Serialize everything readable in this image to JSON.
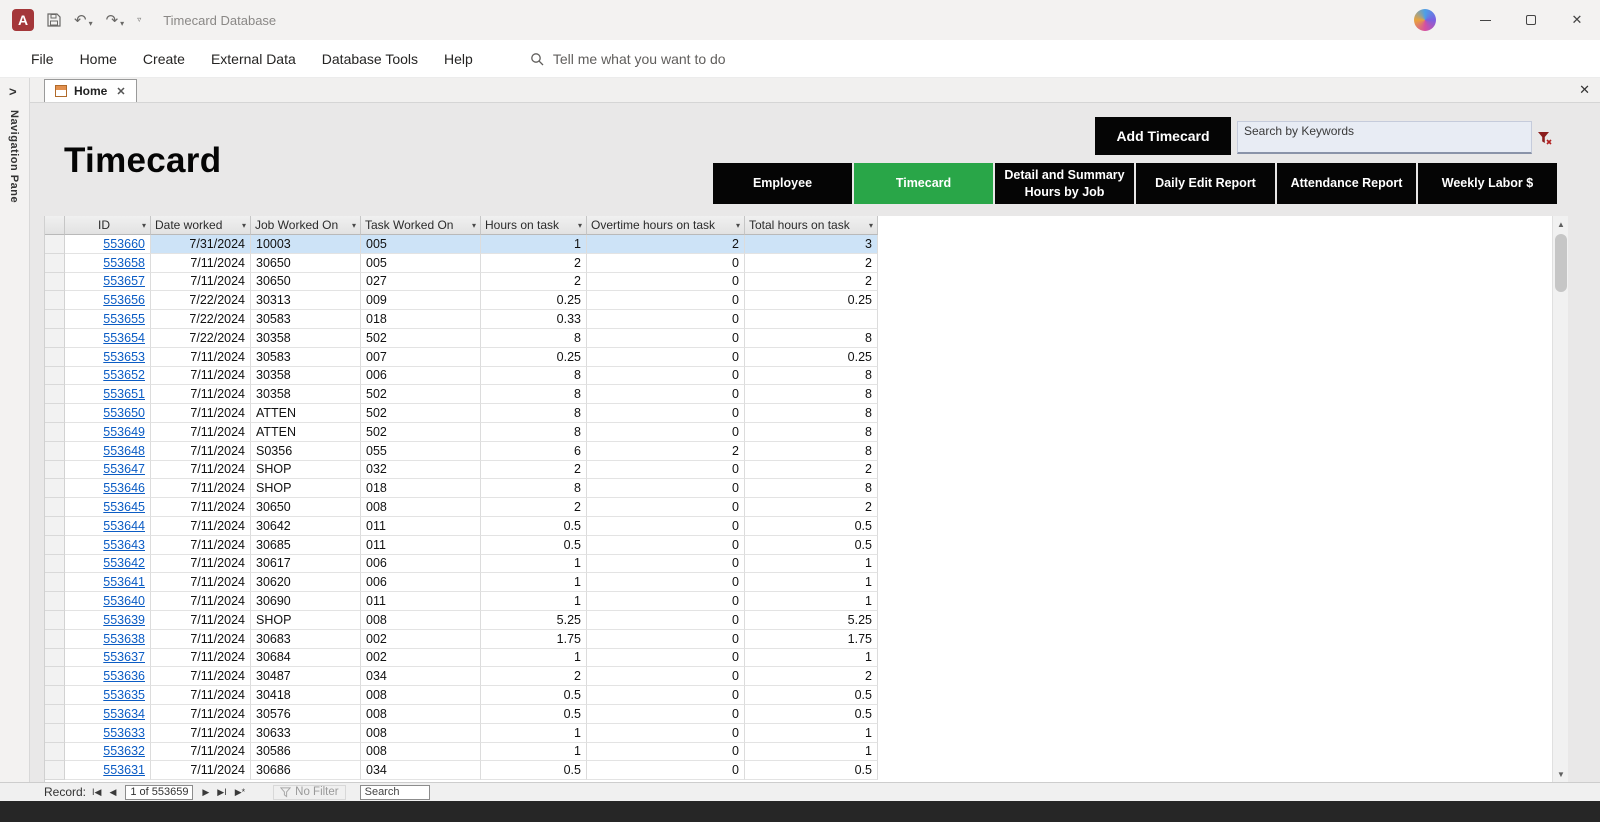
{
  "colors": {
    "accent_green": "#29a648",
    "button_black": "#050505",
    "access_red": "#a4373a",
    "link_blue": "#0b5cc4",
    "selected_row": "#cde3f7"
  },
  "titlebar": {
    "title": "Timecard Database"
  },
  "ribbon": {
    "tabs": [
      "File",
      "Home",
      "Create",
      "External Data",
      "Database Tools",
      "Help"
    ],
    "tell_me": "Tell me what you want to do"
  },
  "doc_tab": {
    "label": "Home"
  },
  "nav_pane": {
    "label": "Navigation Pane"
  },
  "form": {
    "title": "Timecard",
    "add_button_label": "Add Timecard",
    "search_placeholder": "Search by Keywords",
    "nav_buttons": [
      {
        "label": "Employee",
        "active": false
      },
      {
        "label": "Timecard",
        "active": true
      },
      {
        "label": "Detail and Summary Hours by Job",
        "active": false
      },
      {
        "label": "Daily Edit Report",
        "active": false
      },
      {
        "label": "Attendance Report",
        "active": false
      },
      {
        "label": "Weekly Labor $",
        "active": false
      }
    ]
  },
  "table": {
    "columns": [
      "ID",
      "Date worked",
      "Job Worked On",
      "Task Worked On",
      "Hours on task",
      "Overtime hours on task",
      "Total hours on task"
    ],
    "selected_row_index": 0,
    "rows": [
      [
        "553660",
        "7/31/2024",
        "10003",
        "005",
        "1",
        "2",
        "3"
      ],
      [
        "553658",
        "7/11/2024",
        "30650",
        "005",
        "2",
        "0",
        "2"
      ],
      [
        "553657",
        "7/11/2024",
        "30650",
        "027",
        "2",
        "0",
        "2"
      ],
      [
        "553656",
        "7/22/2024",
        "30313",
        "009",
        "0.25",
        "0",
        "0.25"
      ],
      [
        "553655",
        "7/22/2024",
        "30583",
        "018",
        "0.33",
        "0",
        ""
      ],
      [
        "553654",
        "7/22/2024",
        "30358",
        "502",
        "8",
        "0",
        "8"
      ],
      [
        "553653",
        "7/11/2024",
        "30583",
        "007",
        "0.25",
        "0",
        "0.25"
      ],
      [
        "553652",
        "7/11/2024",
        "30358",
        "006",
        "8",
        "0",
        "8"
      ],
      [
        "553651",
        "7/11/2024",
        "30358",
        "502",
        "8",
        "0",
        "8"
      ],
      [
        "553650",
        "7/11/2024",
        "ATTEN",
        "502",
        "8",
        "0",
        "8"
      ],
      [
        "553649",
        "7/11/2024",
        "ATTEN",
        "502",
        "8",
        "0",
        "8"
      ],
      [
        "553648",
        "7/11/2024",
        "S0356",
        "055",
        "6",
        "2",
        "8"
      ],
      [
        "553647",
        "7/11/2024",
        "SHOP",
        "032",
        "2",
        "0",
        "2"
      ],
      [
        "553646",
        "7/11/2024",
        "SHOP",
        "018",
        "8",
        "0",
        "8"
      ],
      [
        "553645",
        "7/11/2024",
        "30650",
        "008",
        "2",
        "0",
        "2"
      ],
      [
        "553644",
        "7/11/2024",
        "30642",
        "011",
        "0.5",
        "0",
        "0.5"
      ],
      [
        "553643",
        "7/11/2024",
        "30685",
        "011",
        "0.5",
        "0",
        "0.5"
      ],
      [
        "553642",
        "7/11/2024",
        "30617",
        "006",
        "1",
        "0",
        "1"
      ],
      [
        "553641",
        "7/11/2024",
        "30620",
        "006",
        "1",
        "0",
        "1"
      ],
      [
        "553640",
        "7/11/2024",
        "30690",
        "011",
        "1",
        "0",
        "1"
      ],
      [
        "553639",
        "7/11/2024",
        "SHOP",
        "008",
        "5.25",
        "0",
        "5.25"
      ],
      [
        "553638",
        "7/11/2024",
        "30683",
        "002",
        "1.75",
        "0",
        "1.75"
      ],
      [
        "553637",
        "7/11/2024",
        "30684",
        "002",
        "1",
        "0",
        "1"
      ],
      [
        "553636",
        "7/11/2024",
        "30487",
        "034",
        "2",
        "0",
        "2"
      ],
      [
        "553635",
        "7/11/2024",
        "30418",
        "008",
        "0.5",
        "0",
        "0.5"
      ],
      [
        "553634",
        "7/11/2024",
        "30576",
        "008",
        "0.5",
        "0",
        "0.5"
      ],
      [
        "553633",
        "7/11/2024",
        "30633",
        "008",
        "1",
        "0",
        "1"
      ],
      [
        "553632",
        "7/11/2024",
        "30586",
        "008",
        "1",
        "0",
        "1"
      ],
      [
        "553631",
        "7/11/2024",
        "30686",
        "034",
        "0.5",
        "0",
        "0.5"
      ]
    ]
  },
  "statusbar": {
    "record_label": "Record:",
    "record_position": "1 of 553659",
    "no_filter_label": "No Filter",
    "search_placeholder": "Search"
  }
}
